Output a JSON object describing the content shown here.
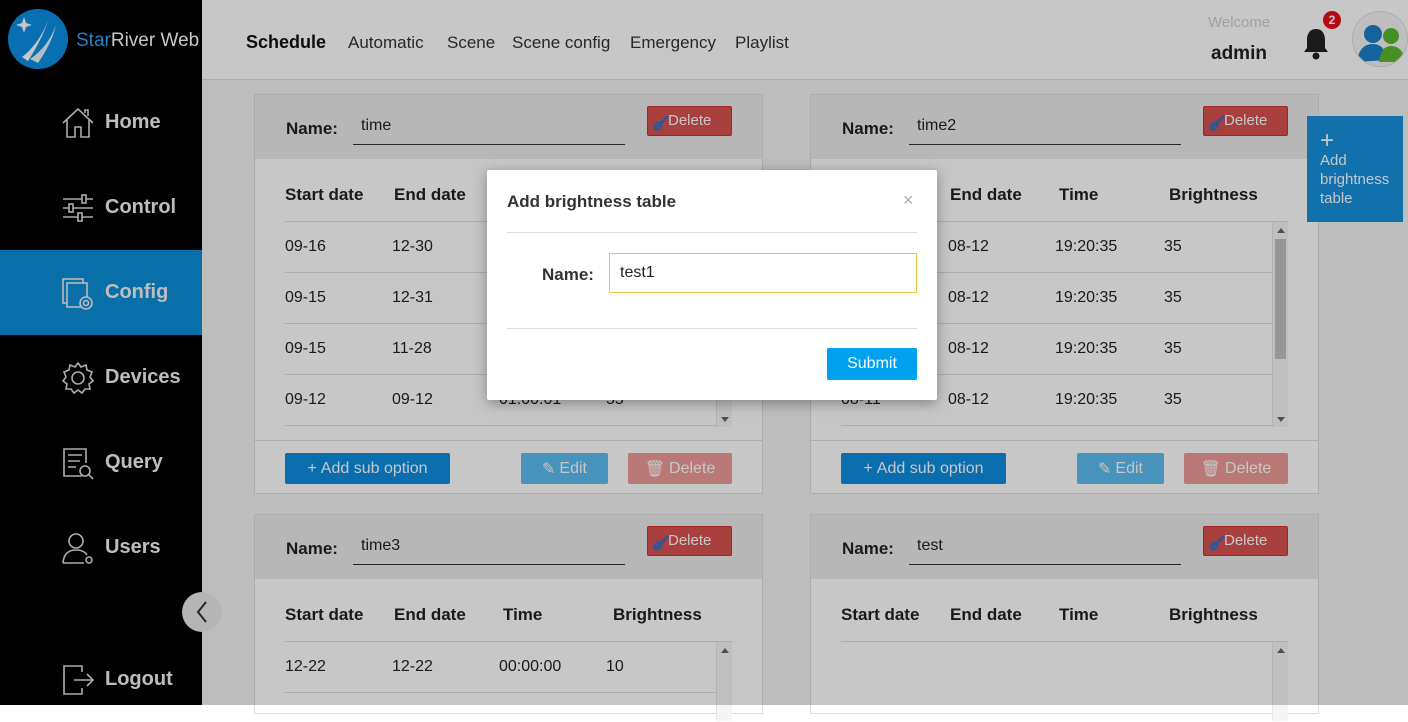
{
  "app": {
    "brand_prefix": "Star",
    "brand_suffix": "River Web"
  },
  "sidebar": {
    "items": [
      {
        "label": "Home",
        "icon": "home-icon"
      },
      {
        "label": "Control",
        "icon": "sliders-icon"
      },
      {
        "label": "Config",
        "icon": "config-icon",
        "active": true
      },
      {
        "label": "Devices",
        "icon": "gear-icon"
      },
      {
        "label": "Query",
        "icon": "query-icon"
      },
      {
        "label": "Users",
        "icon": "user-icon"
      },
      {
        "label": "Logout",
        "icon": "logout-icon"
      }
    ]
  },
  "topbar": {
    "tabs": [
      "Schedule",
      "Automatic",
      "Scene",
      "Scene config",
      "Emergency",
      "Playlist"
    ],
    "active_tab": "Schedule",
    "welcome": "Welcome",
    "username": "admin",
    "notification_count": "2"
  },
  "labels": {
    "name": "Name:",
    "delete": "Delete",
    "start_date": "Start date",
    "end_date": "End date",
    "time": "Time",
    "brightness": "Brightness",
    "add_sub_option": "Add sub option",
    "edit": "Edit"
  },
  "add_table_button": {
    "plus": "+",
    "label": "Add brightness table"
  },
  "cards": [
    {
      "name": "time",
      "rows": [
        [
          "09-16",
          "12-30",
          "",
          ""
        ],
        [
          "09-15",
          "12-31",
          "",
          ""
        ],
        [
          "09-15",
          "11-28",
          "",
          ""
        ],
        [
          "09-12",
          "09-12",
          "01:00:01",
          "55"
        ]
      ]
    },
    {
      "name": "time2",
      "rows": [
        [
          "",
          "08-12",
          "19:20:35",
          "35"
        ],
        [
          "",
          "08-12",
          "19:20:35",
          "35"
        ],
        [
          "",
          "08-12",
          "19:20:35",
          "35"
        ],
        [
          "08-11",
          "08-12",
          "19:20:35",
          "35"
        ]
      ]
    },
    {
      "name": "time3",
      "rows": [
        [
          "12-22",
          "12-22",
          "00:00:00",
          "10"
        ]
      ]
    },
    {
      "name": "test",
      "rows": []
    }
  ],
  "modal": {
    "title": "Add brightness table",
    "close": "×",
    "name_label": "Name:",
    "name_value": "test1",
    "submit": "Submit"
  },
  "colors": {
    "accent": "#0c8fd8",
    "danger": "#d9534f",
    "primary_button": "#0e8ddf",
    "submit": "#00a2ef"
  }
}
